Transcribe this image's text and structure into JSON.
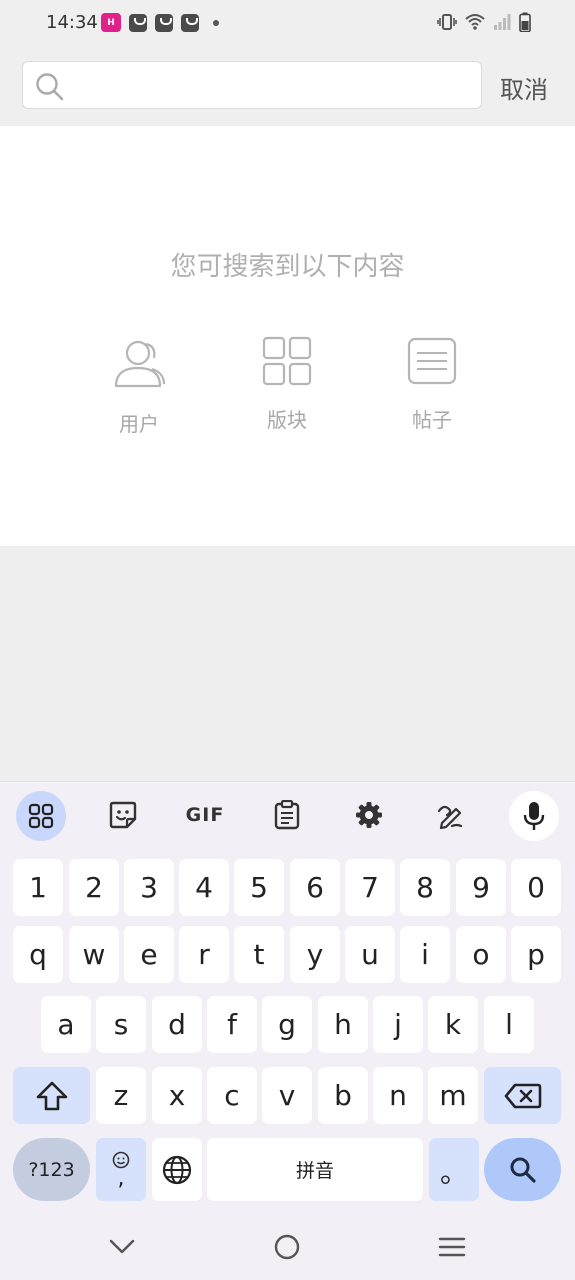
{
  "status_bar": {
    "time": "14:34",
    "notification_app_label": "H",
    "icons": [
      "app-notification-icon",
      "bag-icon",
      "bag-icon",
      "bag-icon",
      "dot-icon",
      "vibrate-icon",
      "wifi-icon",
      "signal-icon",
      "battery-icon"
    ]
  },
  "search": {
    "placeholder": "",
    "value": "",
    "cancel_label": "取消"
  },
  "content": {
    "hint": "您可搜索到以下内容",
    "categories": [
      {
        "label": "用户",
        "icon": "user-icon"
      },
      {
        "label": "版块",
        "icon": "grid-icon"
      },
      {
        "label": "帖子",
        "icon": "post-icon"
      }
    ]
  },
  "keyboard": {
    "toolbar": [
      "apps-grid-icon",
      "sticker-icon",
      "GIF",
      "clipboard-icon",
      "settings-icon",
      "handwriting-icon",
      "mic-icon"
    ],
    "gif_label": "GIF",
    "row_numbers": [
      "1",
      "2",
      "3",
      "4",
      "5",
      "6",
      "7",
      "8",
      "9",
      "0"
    ],
    "row1": [
      "q",
      "w",
      "e",
      "r",
      "t",
      "y",
      "u",
      "i",
      "o",
      "p"
    ],
    "row2": [
      "a",
      "s",
      "d",
      "f",
      "g",
      "h",
      "j",
      "k",
      "l"
    ],
    "row3": [
      "z",
      "x",
      "c",
      "v",
      "b",
      "n",
      "m"
    ],
    "symbols_label": "?123",
    "comma_label": ",",
    "space_label": "拼音",
    "period_label": "。",
    "colors": {
      "accent": "#aec8f9",
      "toolbar_active": "#c8d7fb",
      "background": "#f3eff7"
    }
  },
  "nav_bar": [
    "back-chevron-icon",
    "home-circle-icon",
    "menu-lines-icon"
  ]
}
